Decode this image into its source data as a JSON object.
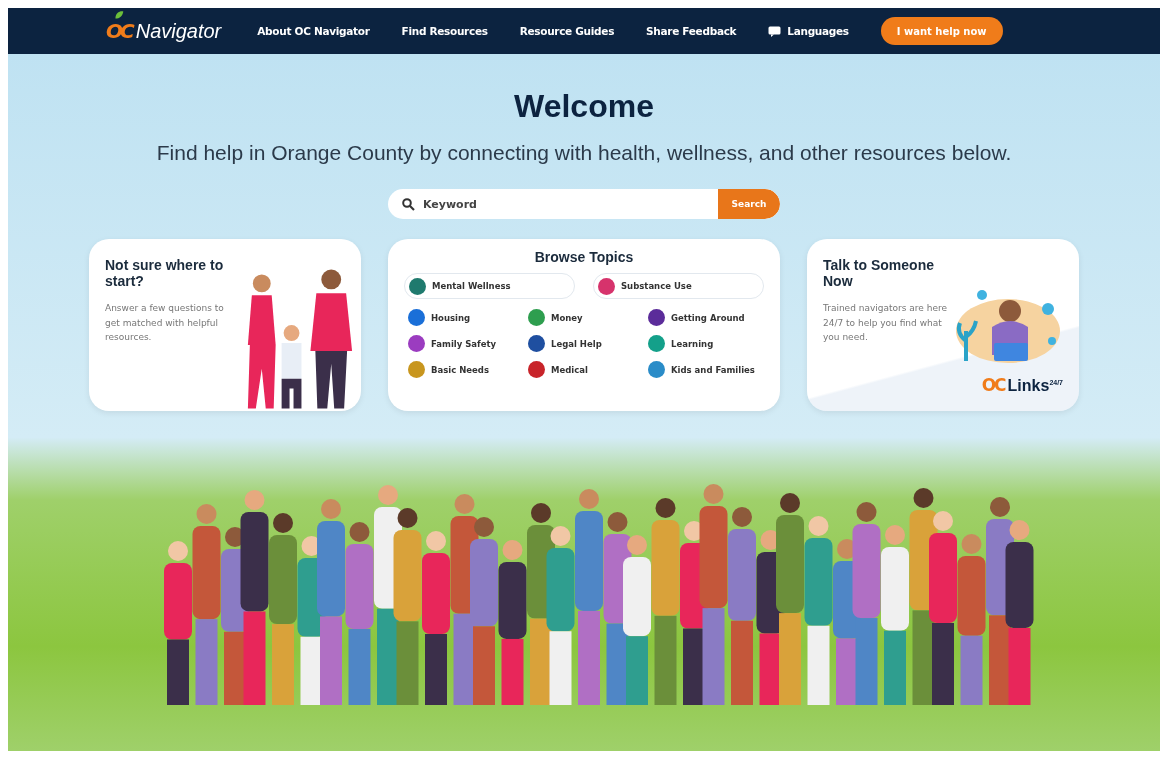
{
  "nav": {
    "brand_mark": "OC",
    "brand": "Navigator",
    "links": [
      "About OC Navigator",
      "Find Resources",
      "Resource Guides",
      "Share Feedback"
    ],
    "language": "Languages",
    "cta": "I want help now"
  },
  "hero": {
    "title": "Welcome",
    "subtitle": "Find help in Orange County by connecting with health, wellness, and other resources below."
  },
  "search": {
    "placeholder": "Keyword",
    "button": "Search"
  },
  "start_card": {
    "title": "Not sure where to start?",
    "text": "Answer a few questions to get matched with helpful resources."
  },
  "topics": {
    "title": "Browse Topics",
    "items": [
      {
        "label": "Mental Wellness",
        "kind": "pill",
        "color": "#1f7a6e"
      },
      {
        "label": "Substance Use",
        "kind": "pill",
        "color": "#d6336c"
      },
      {
        "label": "Housing",
        "kind": "plain",
        "color": "#1a6fd8"
      },
      {
        "label": "Money",
        "kind": "plain",
        "color": "#2e9e4f"
      },
      {
        "label": "Getting Around",
        "kind": "plain",
        "color": "#5b2c9a"
      },
      {
        "label": "Family Safety",
        "kind": "plain",
        "color": "#9b3cc0"
      },
      {
        "label": "Legal Help",
        "kind": "plain",
        "color": "#1f4fa0"
      },
      {
        "label": "Learning",
        "kind": "plain",
        "color": "#14a08a"
      },
      {
        "label": "Basic Needs",
        "kind": "plain",
        "color": "#c8961e"
      },
      {
        "label": "Medical",
        "kind": "plain",
        "color": "#c8242a"
      },
      {
        "label": "Kids and Families",
        "kind": "plain",
        "color": "#2a8cc8"
      }
    ]
  },
  "talk_card": {
    "title": "Talk to Someone Now",
    "text": "Trained navigators are here 24/7 to help you find what you need.",
    "logo_mark": "OC",
    "logo": "Links$^{24/7}$"
  }
}
